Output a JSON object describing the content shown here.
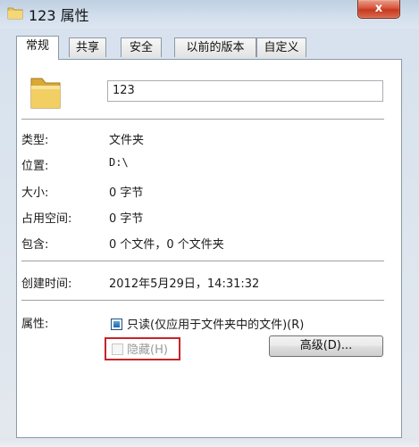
{
  "window": {
    "title": "123 属性",
    "close_label": "x"
  },
  "tabs": [
    {
      "label": "常规",
      "active": true
    },
    {
      "label": "共享",
      "active": false
    },
    {
      "label": "安全",
      "active": false
    },
    {
      "label": "以前的版本",
      "active": false
    },
    {
      "label": "自定义",
      "active": false
    }
  ],
  "general": {
    "name": "123",
    "type_label": "类型:",
    "type_value": "文件夹",
    "location_label": "位置:",
    "location_value": "D:\\",
    "size_label": "大小:",
    "size_value": "0 字节",
    "size_on_disk_label": "占用空间:",
    "size_on_disk_value": "0 字节",
    "contains_label": "包含:",
    "contains_value": "0 个文件，0 个文件夹",
    "created_label": "创建时间:",
    "created_value": "2012年5月29日，14:31:32",
    "attributes_label": "属性:",
    "readonly_label": "只读(仅应用于文件夹中的文件)(R)",
    "readonly_state": "partial",
    "hidden_label": "隐藏(H)",
    "hidden_checked": false,
    "advanced_button": "高级(D)..."
  },
  "colors": {
    "highlight": "#c8232a",
    "accent": "#1e65a6"
  }
}
